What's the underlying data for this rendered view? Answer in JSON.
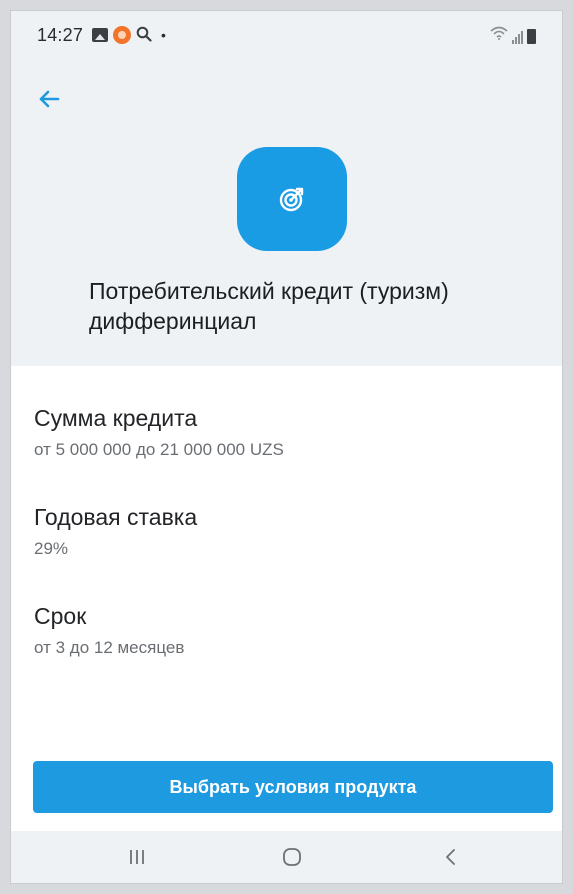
{
  "status_bar": {
    "time": "14:27",
    "icons": [
      "gallery-icon",
      "app-notification-icon",
      "search-icon",
      "dot-icon",
      "wifi-icon",
      "signal-icon",
      "battery-icon"
    ]
  },
  "header": {
    "back_icon": "arrow-left-icon",
    "product_icon": "target-icon",
    "title": "Потребительский кредит (туризм) дифферинциал"
  },
  "details": [
    {
      "label": "Сумма кредита",
      "value": "от 5 000 000 до 21 000 000 UZS"
    },
    {
      "label": "Годовая ставка",
      "value": "29%"
    },
    {
      "label": "Срок",
      "value": "от 3 до 12 месяцев"
    }
  ],
  "primary_button": {
    "label": "Выбрать условия продукта"
  },
  "nav_bar": {
    "icons": [
      "recent-apps-icon",
      "home-icon",
      "back-icon"
    ]
  },
  "colors": {
    "accent": "#1e9ae0",
    "icon_tile": "#1a9ce5",
    "header_bg": "#eef2f5",
    "text_primary": "#222427",
    "text_secondary": "#6a6e73"
  }
}
